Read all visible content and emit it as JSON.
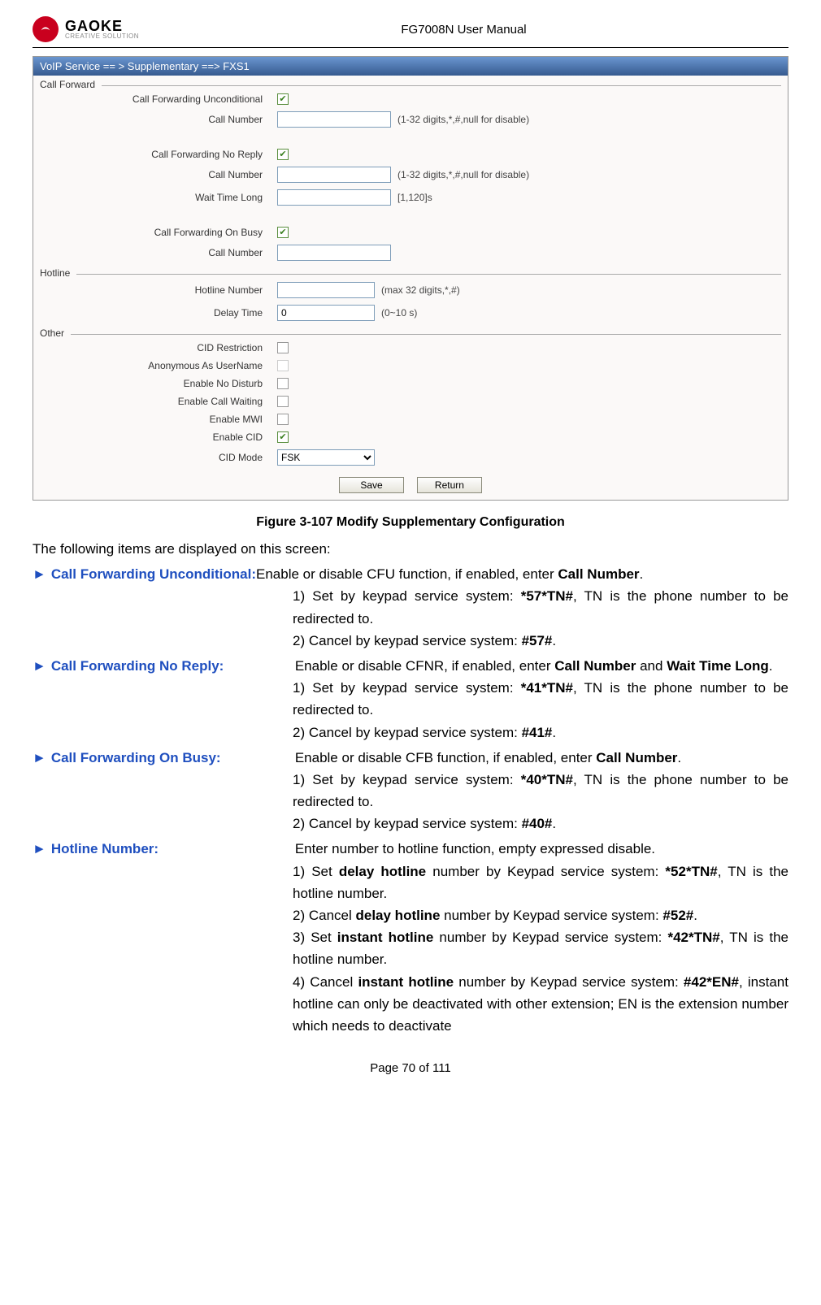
{
  "header": {
    "brand": "GAOKE",
    "tagline": "CREATIVE SOLUTION",
    "doc_title": "FG7008N User Manual"
  },
  "window": {
    "titlebar": "VoIP Service == > Supplementary ==> FXS1",
    "sections": {
      "call_forward": {
        "title": "Call Forward",
        "cfu_label": "Call Forwarding Unconditional",
        "cfu_callnum_label": "Call Number",
        "cfu_hint": "(1-32 digits,*,#,null for disable)",
        "cfnr_label": "Call Forwarding No Reply",
        "cfnr_callnum_label": "Call Number",
        "cfnr_hint": "(1-32 digits,*,#,null for disable)",
        "cfnr_wait_label": "Wait Time Long",
        "cfnr_wait_hint": "[1,120]s",
        "cfb_label": "Call Forwarding On Busy",
        "cfb_callnum_label": "Call Number"
      },
      "hotline": {
        "title": "Hotline",
        "hotline_num_label": "Hotline Number",
        "hotline_num_hint": "(max 32 digits,*,#)",
        "delay_label": "Delay Time",
        "delay_value": "0",
        "delay_hint": "(0~10 s)"
      },
      "other": {
        "title": "Other",
        "cid_restriction": "CID Restriction",
        "anon_username": "Anonymous As UserName",
        "no_disturb": "Enable No Disturb",
        "call_waiting": "Enable Call Waiting",
        "mwi": "Enable MWI",
        "enable_cid": "Enable CID",
        "cid_mode": "CID Mode",
        "cid_mode_value": "FSK"
      }
    },
    "buttons": {
      "save": "Save",
      "return": "Return"
    }
  },
  "figure_caption": "Figure 3-107 Modify Supplementary Configuration",
  "prose": {
    "intro": "The following items are displayed on this screen:",
    "cfu_name": "Call Forwarding Unconditional:",
    "cfu_desc0": " Enable or disable CFU function, if enabled, enter ",
    "cfu_desc0b": "Call Number",
    "cfu_desc0c": ".",
    "cfu_desc1a": "1) Set by keypad service system: ",
    "cfu_desc1b": "*57*TN#",
    "cfu_desc1c": ", TN is the phone number to be redirected to.",
    "cfu_desc2a": "2) Cancel by keypad service system:   ",
    "cfu_desc2b": "#57#",
    "cfu_desc2c": ".",
    "cfnr_name": "Call Forwarding No Reply:",
    "cfnr_desc0a": "Enable or disable CFNR, if enabled, enter ",
    "cfnr_desc0b": "Call Number",
    "cfnr_desc0c": " and ",
    "cfnr_desc0d": "Wait Time Long",
    "cfnr_desc0e": ".",
    "cfnr_desc1a": "1) Set by keypad service system: ",
    "cfnr_desc1b": "*41*TN#",
    "cfnr_desc1c": ", TN is the phone number to be redirected to.",
    "cfnr_desc2a": "2) Cancel by keypad service system:   ",
    "cfnr_desc2b": "#41#",
    "cfnr_desc2c": ".",
    "cfb_name": "Call Forwarding On Busy:",
    "cfb_desc0a": "Enable or disable CFB function, if enabled, enter ",
    "cfb_desc0b": "Call Number",
    "cfb_desc0c": ".",
    "cfb_desc1a": "1) Set by keypad service system: ",
    "cfb_desc1b": "*40*TN#",
    "cfb_desc1c": ", TN is the phone number to be redirected to.",
    "cfb_desc2a": "2) Cancel by keypad service system:   ",
    "cfb_desc2b": "#40#",
    "cfb_desc2c": ".",
    "hotline_name": "Hotline Number:",
    "hotline_desc0": "Enter number to hotline function, empty expressed disable.",
    "hotline_desc1a": "1) Set ",
    "hotline_desc1b": "delay hotline",
    "hotline_desc1c": " number by Keypad service system: ",
    "hotline_desc1d": "*52*TN#",
    "hotline_desc1e": ", TN is the hotline number.",
    "hotline_desc2a": "2) Cancel ",
    "hotline_desc2b": "delay hotline",
    "hotline_desc2c": " number by Keypad service system: ",
    "hotline_desc2d": "#52#",
    "hotline_desc2e": ".",
    "hotline_desc3a": "3) Set ",
    "hotline_desc3b": "instant hotline",
    "hotline_desc3c": " number by Keypad service system: ",
    "hotline_desc3d": "*42*TN#",
    "hotline_desc3e": ", TN is the hotline number.",
    "hotline_desc4a": "4) Cancel ",
    "hotline_desc4b": "instant hotline",
    "hotline_desc4c": " number by Keypad service system: ",
    "hotline_desc4d": "#42*EN#",
    "hotline_desc4e": ", instant hotline can only be deactivated with other extension; EN is the extension number which needs to deactivate"
  },
  "footer": "Page 70 of 111"
}
